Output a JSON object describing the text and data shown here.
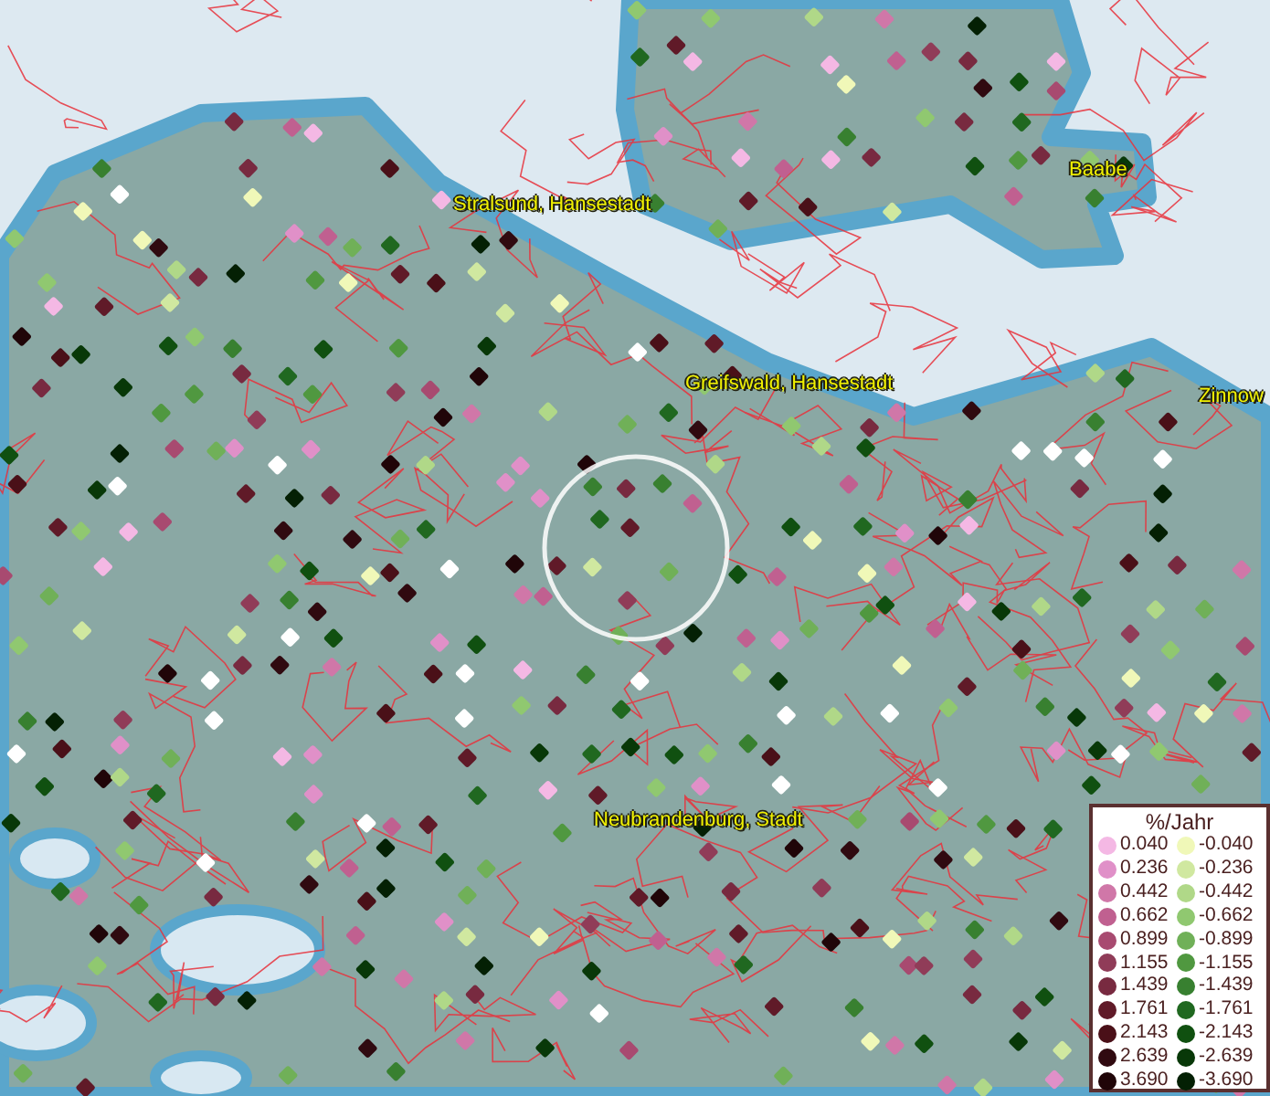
{
  "map": {
    "places": [
      {
        "name": "Stralsund, Hansestadt"
      },
      {
        "name": "Baabe"
      },
      {
        "name": "Greifswald, Hansestadt"
      },
      {
        "name": "Zinnow"
      },
      {
        "name": "Neubrandenburg, Stadt"
      }
    ]
  },
  "legend": {
    "title": "%/Jahr",
    "positive": [
      {
        "value": "0.040",
        "color": "#f4b8e4"
      },
      {
        "value": "0.236",
        "color": "#e090c8"
      },
      {
        "value": "0.442",
        "color": "#d077a8"
      },
      {
        "value": "0.662",
        "color": "#c06090"
      },
      {
        "value": "0.899",
        "color": "#a84a70"
      },
      {
        "value": "1.155",
        "color": "#903c58"
      },
      {
        "value": "1.439",
        "color": "#782a40"
      },
      {
        "value": "1.761",
        "color": "#601a28"
      },
      {
        "value": "2.143",
        "color": "#4a1018"
      },
      {
        "value": "2.639",
        "color": "#300a10"
      },
      {
        "value": "3.690",
        "color": "#200508"
      }
    ],
    "negative": [
      {
        "value": "-0.040",
        "color": "#f0f8b8"
      },
      {
        "value": "-0.236",
        "color": "#d0e8a0"
      },
      {
        "value": "-0.442",
        "color": "#b0d888"
      },
      {
        "value": "-0.662",
        "color": "#90c870"
      },
      {
        "value": "-0.899",
        "color": "#70b058"
      },
      {
        "value": "-1.155",
        "color": "#509840"
      },
      {
        "value": "-1.439",
        "color": "#388030"
      },
      {
        "value": "-1.761",
        "color": "#206820"
      },
      {
        "value": "-2.143",
        "color": "#105010"
      },
      {
        "value": "-2.639",
        "color": "#083808"
      },
      {
        "value": "-3.690",
        "color": "#042004"
      }
    ]
  }
}
